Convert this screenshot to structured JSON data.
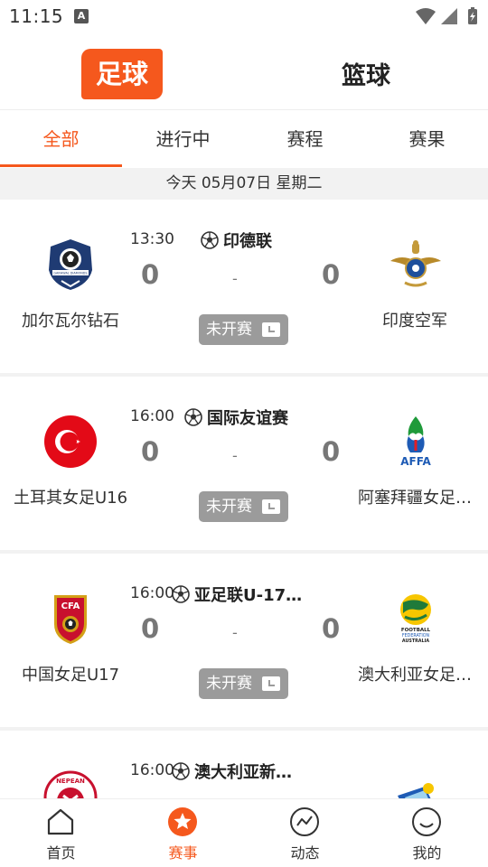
{
  "status_bar": {
    "time": "11:15",
    "a_badge": "A"
  },
  "sport_tabs": {
    "football": "足球",
    "basketball": "篮球"
  },
  "subtabs": [
    "全部",
    "进行中",
    "赛程",
    "赛果"
  ],
  "date_label": "今天 05月07日 星期二",
  "matches": [
    {
      "time": "13:30",
      "league": "印德联",
      "home": "加尔瓦尔钻石",
      "away": "印度空军",
      "home_score": "0",
      "away_score": "0",
      "sep": "-",
      "status": "未开赛"
    },
    {
      "time": "16:00",
      "league": "国际友谊赛",
      "home": "土耳其女足U16",
      "away": "阿塞拜疆女足…",
      "home_score": "0",
      "away_score": "0",
      "sep": "-",
      "status": "未开赛"
    },
    {
      "time": "16:00",
      "league": "亚足联U-17…",
      "home": "中国女足U17",
      "away": "澳大利亚女足…",
      "home_score": "0",
      "away_score": "0",
      "sep": "-",
      "status": "未开赛"
    },
    {
      "time": "16:00",
      "league": "澳大利亚新…",
      "home_logo_text": "NEPEAN",
      "away_logo_text": ""
    }
  ],
  "logo_text": {
    "cfa": "CFA",
    "affa": "AFFA",
    "ffa_line1": "FOOTBALL",
    "ffa_line2": "FEDERATION",
    "ffa_line3": "AUSTRALIA",
    "garhwal": "GARHWAL DIAMONDS"
  },
  "bottom_nav": [
    {
      "label": "首页",
      "icon": "home-icon"
    },
    {
      "label": "赛事",
      "icon": "star-icon"
    },
    {
      "label": "动态",
      "icon": "trend-icon"
    },
    {
      "label": "我的",
      "icon": "smile-icon"
    }
  ],
  "colors": {
    "accent": "#f5581d",
    "status_pill": "#9b9b9b"
  }
}
